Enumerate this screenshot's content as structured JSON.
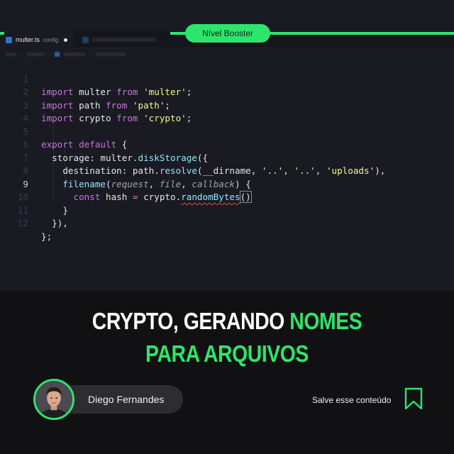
{
  "header": {
    "badge": "Nível Booster",
    "tab_active": {
      "filename": "multer.ts",
      "folder": "config"
    },
    "tab_inactive": {
      "filename": ""
    }
  },
  "editor": {
    "current_line": 9,
    "lines": [
      {
        "n": "1"
      },
      {
        "n": "2"
      },
      {
        "n": "3"
      },
      {
        "n": "4"
      },
      {
        "n": "5"
      },
      {
        "n": "6"
      },
      {
        "n": "7"
      },
      {
        "n": "8"
      },
      {
        "n": "9"
      },
      {
        "n": "10"
      },
      {
        "n": "11"
      },
      {
        "n": "12"
      }
    ],
    "code": {
      "l1_kw": "import",
      "l1_mod": " multer ",
      "l1_from": "from",
      "l1_str": " 'multer'",
      "l1_end": ";",
      "l2_kw": "import",
      "l2_mod": " path ",
      "l2_from": "from",
      "l2_str": " 'path'",
      "l2_end": ";",
      "l3_kw": "import",
      "l3_mod": " crypto ",
      "l3_from": "from",
      "l3_str": " 'crypto'",
      "l3_end": ";",
      "l5_kw": "export",
      "l5_def": " default",
      "l5_end": " {",
      "l6_prop": "  storage: ",
      "l6_obj": "multer.",
      "l6_fn": "diskStorage",
      "l6_end": "({",
      "l7_prop": "    destination: ",
      "l7_obj": "path.",
      "l7_fn": "resolve",
      "l7_a": "(__dirname, ",
      "l7_s1": "'..'",
      "l7_c1": ", ",
      "l7_s2": "'..'",
      "l7_c2": ", ",
      "l7_s3": "'uploads'",
      "l7_end": "),",
      "l8_fn": "    filename",
      "l8_open": "(",
      "l8_p1": "request",
      "l8_c1": ", ",
      "l8_p2": "file",
      "l8_c2": ", ",
      "l8_p3": "callback",
      "l8_end": ") {",
      "l9_kw": "      const",
      "l9_var": " hash ",
      "l9_op": "=",
      "l9_obj": " crypto.",
      "l9_fn": "randomBytes",
      "l9_end": "()",
      "l10": "    }",
      "l11": "  }),",
      "l12": "};"
    }
  },
  "title": {
    "line1_white": "CRYPTO, GERANDO ",
    "line1_green": "NOMES",
    "line2_green": "PARA ARQUIVOS"
  },
  "author": {
    "name": "Diego Fernandes"
  },
  "save": {
    "label": "Salve esse conteúdo",
    "icon": "bookmark-icon"
  },
  "colors": {
    "accent": "#2ee56b",
    "background": "#111114",
    "editor_bg": "#1a1a22"
  }
}
